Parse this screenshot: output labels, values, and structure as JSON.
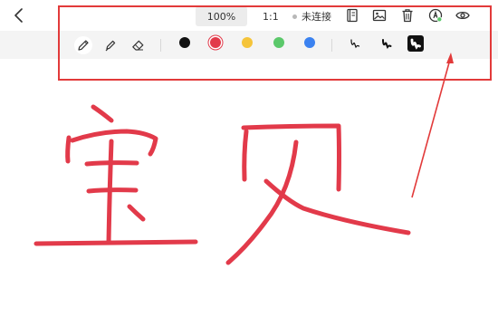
{
  "toolbar": {
    "zoom": "100%",
    "ratio": "1:1",
    "connection_status": "未连接"
  },
  "icons": {
    "back": "chevron-left-icon",
    "notebook": "notebook-icon",
    "image": "image-icon",
    "delete": "trash-icon",
    "pen_status": "pen-status-icon",
    "preview": "eye-icon",
    "pencil": "pencil-icon",
    "marker": "marker-icon",
    "eraser": "eraser-icon"
  },
  "tools": {
    "selected_tool": "pencil",
    "selected_color": "red",
    "selected_stroke": "thick"
  },
  "colors": {
    "black": "#111111",
    "red": "#e23a4a",
    "yellow": "#f5c43a",
    "green": "#5bc86a",
    "blue": "#3b82f0",
    "ink": "#e23a4a",
    "annotation": "#e23a3a"
  },
  "canvas": {
    "handwriting": "宝贝"
  }
}
